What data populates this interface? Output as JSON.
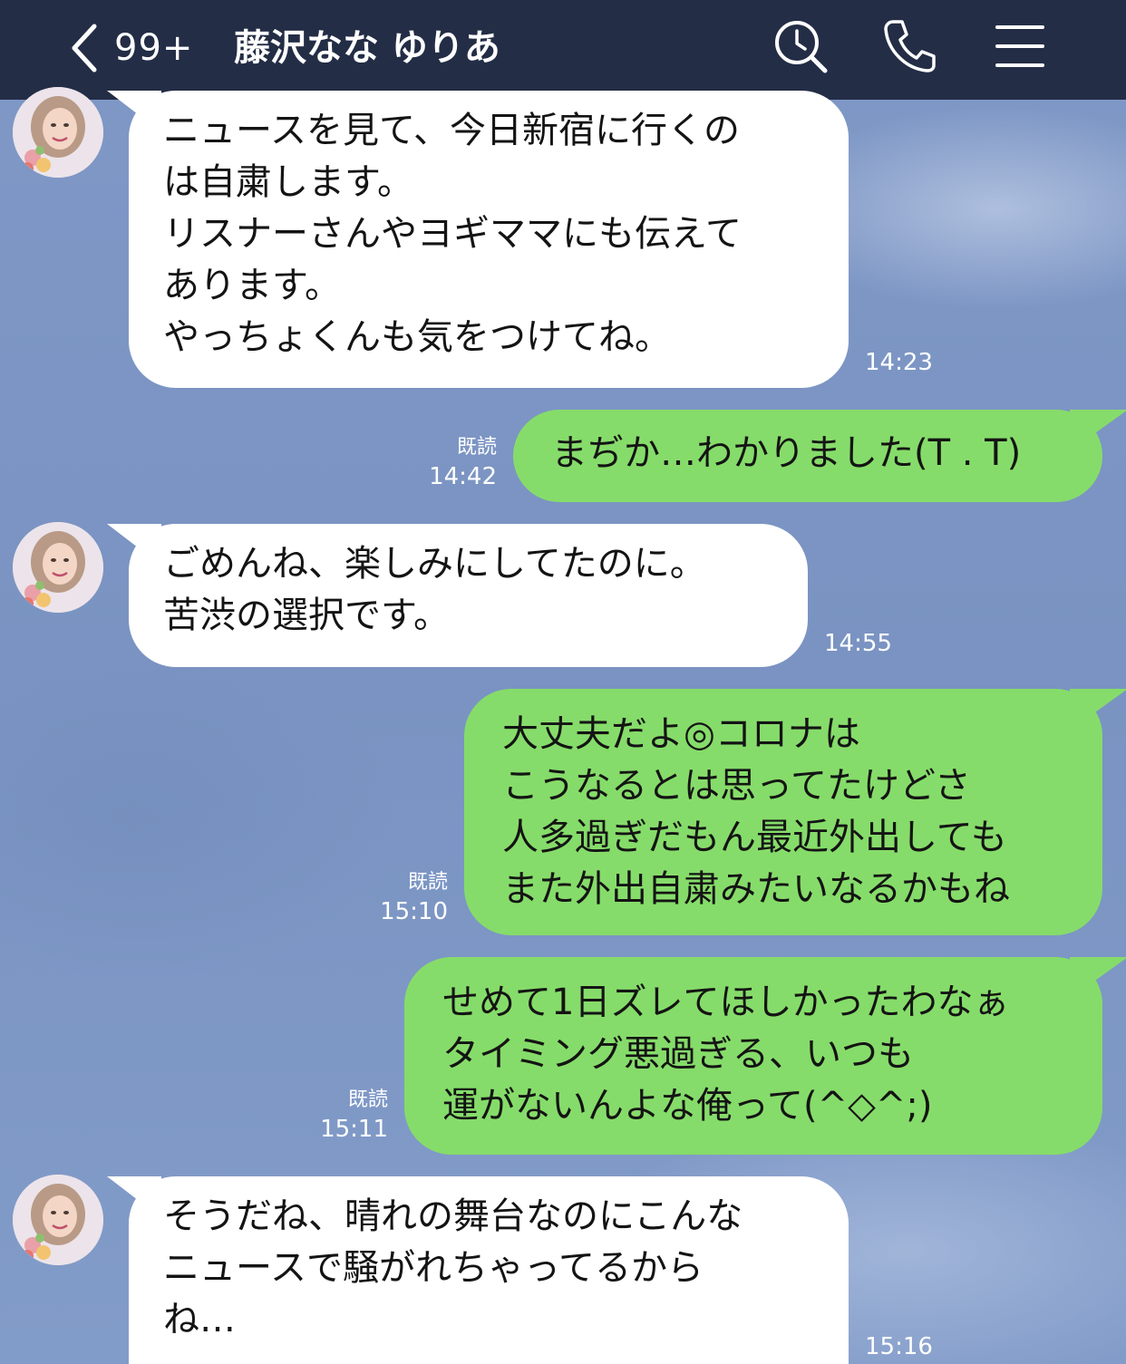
{
  "header": {
    "back_label": "<",
    "unread_count": "99+",
    "title": "藤沢なな ゆりあ",
    "search_icon": "search-clock-icon",
    "call_icon": "phone-icon",
    "menu_icon": "hamburger-menu-icon",
    "background_color": "#232d45"
  },
  "colors": {
    "chat_background": "#7d97c5",
    "incoming_bubble": "#ffffff",
    "outgoing_bubble": "#86dc6a",
    "meta_text": "#ffffff"
  },
  "messages": [
    {
      "direction": "in",
      "text": "ニュースを見て、今日新宿に行くの\nは自粛します。\nリスナーさんやヨギママにも伝えて\nあります。\nやっちょくんも気をつけてね。",
      "time": "14:23"
    },
    {
      "direction": "out",
      "text": "まぢか…わかりました(T . T)",
      "read": "既読",
      "time": "14:42"
    },
    {
      "direction": "in",
      "text": "ごめんね、楽しみにしてたのに。\n苦渋の選択です。",
      "time": "14:55"
    },
    {
      "direction": "out",
      "text": "大丈夫だよ◎コロナは\nこうなるとは思ってたけどさ\n人多過ぎだもん最近外出しても\nまた外出自粛みたいなるかもね",
      "read": "既読",
      "time": "15:10"
    },
    {
      "direction": "out",
      "text": "せめて1日ズレてほしかったわなぁ\nタイミング悪過ぎる、いつも\n運がないんよな俺って(^◇^;)",
      "read": "既読",
      "time": "15:11"
    },
    {
      "direction": "in",
      "text": "そうだね、晴れの舞台なのにこんな\nニュースで騒がれちゃってるから\nね…",
      "time": "15:16"
    }
  ]
}
